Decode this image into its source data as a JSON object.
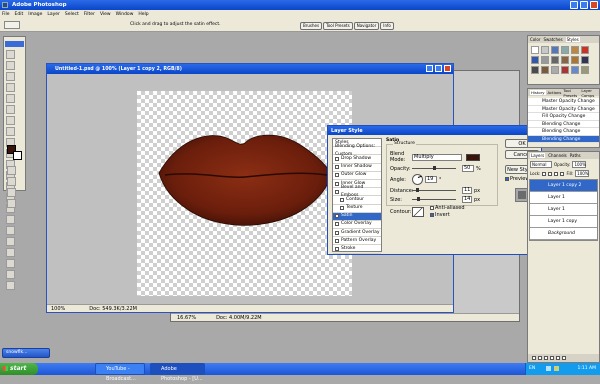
{
  "app": {
    "title": "Adobe Photoshop"
  },
  "menu": [
    "File",
    "Edit",
    "Image",
    "Layer",
    "Select",
    "Filter",
    "View",
    "Window",
    "Help"
  ],
  "options_bar": {
    "hint": "Click and drag to adjust the satin effect."
  },
  "palette_well_tabs": [
    "Brushes",
    "Tool Presets",
    "Navigator",
    "Info"
  ],
  "document": {
    "title": "Untitled-1.psd @ 100% (Layer 1 copy 2, RGB/8)",
    "zoom": "100%",
    "doc_size": "Doc: 549.3K/3.22M"
  },
  "document2": {
    "zoom": "16.67%",
    "doc_size": "Doc: 4.00M/9.22M"
  },
  "layer_style": {
    "title": "Layer Style",
    "styles_header": "Styles",
    "items": [
      "Blending Options: Custom",
      "Drop Shadow",
      "Inner Shadow",
      "Outer Glow",
      "Inner Glow",
      "Bevel and Emboss",
      "Contour",
      "Texture",
      "Satin",
      "Color Overlay",
      "Gradient Overlay",
      "Pattern Overlay",
      "Stroke"
    ],
    "section_title": "Satin",
    "group_title": "Structure",
    "blend_mode_label": "Blend Mode:",
    "blend_mode_value": "Multiply",
    "opacity_label": "Opacity:",
    "opacity_value": "50",
    "percent": "%",
    "angle_label": "Angle:",
    "angle_value": "19",
    "degree": "°",
    "distance_label": "Distance:",
    "distance_value": "11",
    "size_label": "Size:",
    "size_value": "14",
    "px": "px",
    "contour_label": "Contour:",
    "anti_aliased": "Anti-aliased",
    "invert": "Invert",
    "ok": "OK",
    "cancel": "Cancel",
    "new_style": "New Style...",
    "preview": "Preview",
    "satin_color": "#3a1408"
  },
  "styles_panel": {
    "tabs": [
      "Color",
      "Swatches",
      "Styles"
    ]
  },
  "history_panel": {
    "tabs": [
      "History",
      "Actions",
      "Tool Presets",
      "Layer Comps"
    ],
    "items": [
      "Master Opacity Change",
      "Master Opacity Change",
      "Fill Opacity Change",
      "Blending Change",
      "Blending Change",
      "Blending Change"
    ]
  },
  "layers_panel": {
    "tabs": [
      "Layers",
      "Channels",
      "Paths"
    ],
    "mode": "Normal",
    "opacity_label": "Opacity:",
    "opacity_value": "100%",
    "lock_label": "Lock:",
    "fill_label": "Fill:",
    "fill_value": "100%",
    "layers": [
      "Layer 1 copy 2",
      "Layer 1",
      "Layer 1",
      "Layer 1 copy",
      "Background"
    ]
  },
  "taskbar": {
    "start": "start",
    "buttons": [
      "YouTube - Broadcast...",
      "Adobe Photoshop - [U..."
    ],
    "clock": "1:11 AM",
    "lang": "EN"
  },
  "desktop_chat": {
    "title": "snowflk..."
  },
  "colors": {
    "lip": "#6b1e0c",
    "foreground": "#3a1408",
    "selection": "#3167c6"
  }
}
